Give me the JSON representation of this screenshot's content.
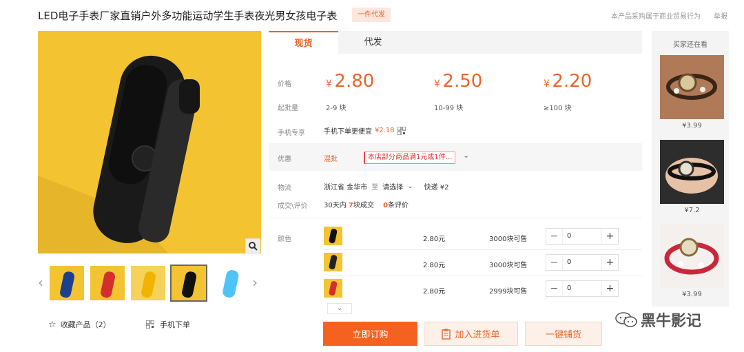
{
  "product": {
    "title": "LED电子手表厂家直销户外多功能运动学生手表夜光男女孩电子表",
    "badge": "一件代发",
    "compliance_note": "本产品采购属于商业贸易行为",
    "report": "举报"
  },
  "gallery": {
    "favorite_label": "收藏产品（2）",
    "mobile_order_label": "手机下单",
    "thumbnails": [
      {
        "color": "#1d3f8f"
      },
      {
        "color": "#d32f2f"
      },
      {
        "color": "#f4c332"
      },
      {
        "color": "#111111"
      },
      {
        "color": "#4fc3f7"
      }
    ]
  },
  "tabs": {
    "spot": "现货",
    "dropship": "代发"
  },
  "pricing": {
    "price_label": "价格",
    "moq_label": "起批量",
    "currency": "¥",
    "tiers": [
      {
        "price": "2.80",
        "range": "2-9 块"
      },
      {
        "price": "2.50",
        "range": "10-99 块"
      },
      {
        "price": "2.20",
        "range": "≥100 块"
      }
    ]
  },
  "mobile_exclusive": {
    "label": "手机专享",
    "text": "手机下单更便宜",
    "price": "¥2.18"
  },
  "promo": {
    "label": "优惠",
    "type": "混批",
    "text": "本店部分商品满1元或1件..."
  },
  "logistics": {
    "label": "物流",
    "origin": "浙江省 金华市",
    "to": "至",
    "destination": "请选择",
    "shipping": "快递 ¥2"
  },
  "sales": {
    "label": "成交\\评价",
    "prefix": "30天内",
    "count": "7",
    "count_suffix": "块成交",
    "reviews": "0",
    "reviews_suffix": "条评价"
  },
  "variants": {
    "label": "颜色",
    "rows": [
      {
        "price": "2.80元",
        "stock": "3000块可售",
        "qty": "0"
      },
      {
        "price": "2.80元",
        "stock": "3000块可售",
        "qty": "0"
      },
      {
        "price": "2.80元",
        "stock": "2999块可售",
        "qty": "0"
      }
    ]
  },
  "actions": {
    "order_now": "立即订购",
    "add_to_cart": "加入进货单",
    "one_click": "一键铺货"
  },
  "sidebar": {
    "title": "买家还在看",
    "items": [
      {
        "price": "¥3.99"
      },
      {
        "price": "¥7.2"
      },
      {
        "price": "¥3.99"
      }
    ]
  },
  "watermark": {
    "text": "黑牛影记"
  },
  "colors": {
    "accent": "#e9642b",
    "button": "#f5621f",
    "yellow_bg": "#f4c332"
  }
}
